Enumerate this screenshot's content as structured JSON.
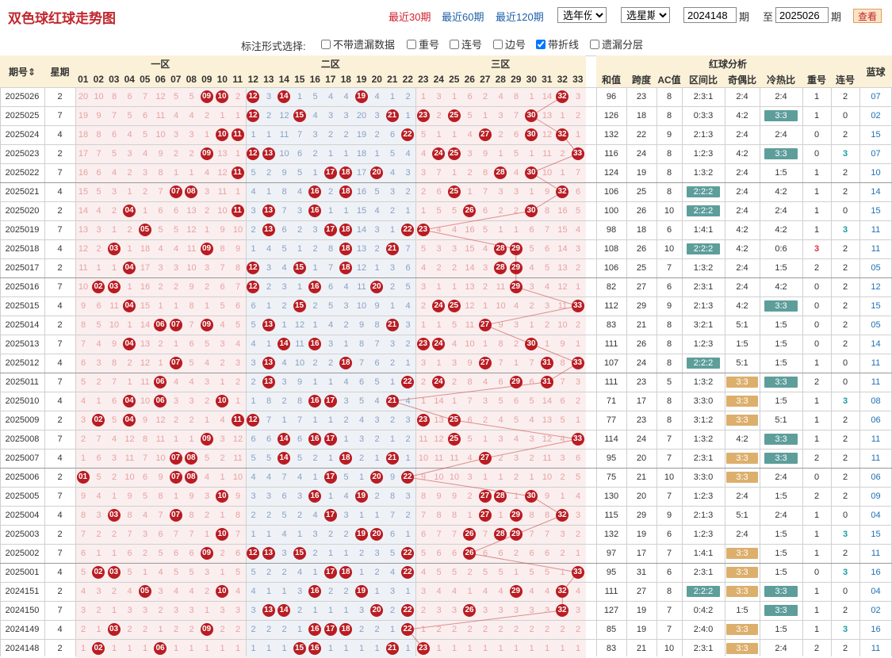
{
  "header": {
    "title": "双色球红球走势图",
    "periods": [
      "最近30期",
      "最近60期",
      "最近120期"
    ],
    "year_select": "选年份",
    "week_select": "选星期",
    "from_value": "2024148",
    "period_unit": "期",
    "to_label": "至",
    "to_value": "2025026",
    "query_button": "查看"
  },
  "options": {
    "label": "标注形式选择:",
    "items": [
      {
        "label": "不带遗漏数据",
        "checked": false
      },
      {
        "label": "重号",
        "checked": false
      },
      {
        "label": "连号",
        "checked": false
      },
      {
        "label": "边号",
        "checked": false
      },
      {
        "label": "带折线",
        "checked": true
      },
      {
        "label": "遗漏分层",
        "checked": false
      }
    ]
  },
  "table_header": {
    "period": "期号",
    "weekday": "星期",
    "zones": [
      "一区",
      "二区",
      "三区"
    ],
    "analysis": "红球分析",
    "blue": "蓝球",
    "analysis_cols": [
      "和值",
      "跨度",
      "AC值",
      "区间比",
      "奇偶比",
      "冷热比",
      "重号",
      "连号"
    ],
    "numbers": [
      "01",
      "02",
      "03",
      "04",
      "05",
      "06",
      "07",
      "08",
      "09",
      "10",
      "11",
      "12",
      "13",
      "14",
      "15",
      "16",
      "17",
      "18",
      "19",
      "20",
      "21",
      "22",
      "23",
      "24",
      "25",
      "26",
      "27",
      "28",
      "29",
      "30",
      "31",
      "32",
      "33"
    ]
  },
  "colors": {
    "ball": "#b91c22",
    "header_bg": "#fbf1d8",
    "badge_teal": "#5d9e9b",
    "badge_gold": "#dcaf6c",
    "blue_text": "#1e6fb5",
    "teal_text": "#1b9aa6",
    "red_text": "#e0303a"
  },
  "rows": [
    {
      "period": "2025026",
      "weekday": "2",
      "balls": [
        "09",
        "10",
        "12",
        "14",
        "19",
        "32"
      ],
      "sum": "96",
      "span": "23",
      "ac": "8",
      "zone": "2:3:1",
      "oe": "2:4",
      "ch": "2:4",
      "repeat": "1",
      "consec": "2",
      "blue": "07"
    },
    {
      "period": "2025025",
      "weekday": "7",
      "balls": [
        "12",
        "15",
        "21",
        "23",
        "25",
        "30"
      ],
      "sum": "126",
      "span": "18",
      "ac": "8",
      "zone": "0:3:3",
      "oe": "4:2",
      "ch": "3:3",
      "repeat": "1",
      "consec": "0",
      "blue": "02"
    },
    {
      "period": "2025024",
      "weekday": "4",
      "balls": [
        "10",
        "11",
        "22",
        "27",
        "30",
        "32"
      ],
      "sum": "132",
      "span": "22",
      "ac": "9",
      "zone": "2:1:3",
      "oe": "2:4",
      "ch": "2:4",
      "repeat": "0",
      "consec": "2",
      "blue": "15"
    },
    {
      "period": "2025023",
      "weekday": "2",
      "balls": [
        "09",
        "12",
        "13",
        "24",
        "25",
        "33"
      ],
      "sum": "116",
      "span": "24",
      "ac": "8",
      "zone": "1:2:3",
      "oe": "4:2",
      "ch": "3:3",
      "repeat": "0",
      "consec": "3",
      "blue": "07"
    },
    {
      "period": "2025022",
      "weekday": "7",
      "balls": [
        "11",
        "17",
        "18",
        "20",
        "28",
        "30"
      ],
      "sum": "124",
      "span": "19",
      "ac": "8",
      "zone": "1:3:2",
      "oe": "2:4",
      "ch": "1:5",
      "repeat": "1",
      "consec": "2",
      "blue": "10"
    },
    {
      "period": "2025021",
      "weekday": "4",
      "balls": [
        "07",
        "08",
        "16",
        "18",
        "25",
        "32"
      ],
      "sum": "106",
      "span": "25",
      "ac": "8",
      "zone": "2:2:2",
      "oe": "2:4",
      "ch": "4:2",
      "repeat": "1",
      "consec": "2",
      "blue": "14"
    },
    {
      "period": "2025020",
      "weekday": "2",
      "balls": [
        "04",
        "11",
        "13",
        "16",
        "26",
        "30"
      ],
      "sum": "100",
      "span": "26",
      "ac": "10",
      "zone": "2:2:2",
      "oe": "2:4",
      "ch": "2:4",
      "repeat": "1",
      "consec": "0",
      "blue": "15"
    },
    {
      "period": "2025019",
      "weekday": "7",
      "balls": [
        "05",
        "13",
        "17",
        "18",
        "22",
        "23"
      ],
      "sum": "98",
      "span": "18",
      "ac": "6",
      "zone": "1:4:1",
      "oe": "4:2",
      "ch": "4:2",
      "repeat": "1",
      "consec": "3",
      "blue": "11"
    },
    {
      "period": "2025018",
      "weekday": "4",
      "balls": [
        "03",
        "09",
        "18",
        "21",
        "28",
        "29"
      ],
      "sum": "108",
      "span": "26",
      "ac": "10",
      "zone": "2:2:2",
      "oe": "4:2",
      "ch": "0:6",
      "repeat": "3",
      "consec": "2",
      "blue": "11"
    },
    {
      "period": "2025017",
      "weekday": "2",
      "balls": [
        "04",
        "12",
        "15",
        "18",
        "28",
        "29"
      ],
      "sum": "106",
      "span": "25",
      "ac": "7",
      "zone": "1:3:2",
      "oe": "2:4",
      "ch": "1:5",
      "repeat": "2",
      "consec": "2",
      "blue": "05"
    },
    {
      "period": "2025016",
      "weekday": "7",
      "balls": [
        "02",
        "03",
        "12",
        "16",
        "20",
        "29"
      ],
      "sum": "82",
      "span": "27",
      "ac": "6",
      "zone": "2:3:1",
      "oe": "2:4",
      "ch": "4:2",
      "repeat": "0",
      "consec": "2",
      "blue": "12"
    },
    {
      "period": "2025015",
      "weekday": "4",
      "balls": [
        "04",
        "15",
        "24",
        "25",
        "33"
      ],
      "sum": "112",
      "span": "29",
      "ac": "9",
      "zone": "2:1:3",
      "oe": "4:2",
      "ch": "3:3",
      "repeat": "0",
      "consec": "2",
      "blue": "15"
    },
    {
      "period": "2025014",
      "weekday": "2",
      "balls": [
        "06",
        "07",
        "09",
        "13",
        "21",
        "27"
      ],
      "sum": "83",
      "span": "21",
      "ac": "8",
      "zone": "3:2:1",
      "oe": "5:1",
      "ch": "1:5",
      "repeat": "0",
      "consec": "2",
      "blue": "05"
    },
    {
      "period": "2025013",
      "weekday": "7",
      "balls": [
        "04",
        "14",
        "16",
        "23",
        "24",
        "30"
      ],
      "sum": "111",
      "span": "26",
      "ac": "8",
      "zone": "1:2:3",
      "oe": "1:5",
      "ch": "1:5",
      "repeat": "0",
      "consec": "2",
      "blue": "14"
    },
    {
      "period": "2025012",
      "weekday": "4",
      "balls": [
        "07",
        "13",
        "18",
        "27",
        "31",
        "33"
      ],
      "sum": "107",
      "span": "24",
      "ac": "8",
      "zone": "2:2:2",
      "oe": "5:1",
      "ch": "1:5",
      "repeat": "1",
      "consec": "0",
      "blue": "11"
    },
    {
      "period": "2025011",
      "weekday": "7",
      "balls": [
        "06",
        "13",
        "22",
        "24",
        "29",
        "31"
      ],
      "sum": "111",
      "span": "23",
      "ac": "5",
      "zone": "1:3:2",
      "oe": "3:3",
      "ch": "3:3",
      "repeat": "2",
      "consec": "0",
      "blue": "11"
    },
    {
      "period": "2025010",
      "weekday": "4",
      "balls": [
        "04",
        "06",
        "10",
        "16",
        "17",
        "21"
      ],
      "sum": "71",
      "span": "17",
      "ac": "8",
      "zone": "3:3:0",
      "oe": "3:3",
      "ch": "1:5",
      "repeat": "1",
      "consec": "3",
      "blue": "08"
    },
    {
      "period": "2025009",
      "weekday": "2",
      "balls": [
        "02",
        "04",
        "11",
        "12",
        "23",
        "25"
      ],
      "sum": "77",
      "span": "23",
      "ac": "8",
      "zone": "3:1:2",
      "oe": "3:3",
      "ch": "5:1",
      "repeat": "1",
      "consec": "2",
      "blue": "06"
    },
    {
      "period": "2025008",
      "weekday": "7",
      "balls": [
        "09",
        "14",
        "16",
        "17",
        "25",
        "33"
      ],
      "sum": "114",
      "span": "24",
      "ac": "7",
      "zone": "1:3:2",
      "oe": "4:2",
      "ch": "3:3",
      "repeat": "1",
      "consec": "2",
      "blue": "11"
    },
    {
      "period": "2025007",
      "weekday": "4",
      "balls": [
        "07",
        "08",
        "14",
        "18",
        "21",
        "27"
      ],
      "sum": "95",
      "span": "20",
      "ac": "7",
      "zone": "2:3:1",
      "oe": "3:3",
      "ch": "3:3",
      "repeat": "2",
      "consec": "2",
      "blue": "11"
    },
    {
      "period": "2025006",
      "weekday": "2",
      "balls": [
        "01",
        "07",
        "08",
        "17",
        "20",
        "22"
      ],
      "sum": "75",
      "span": "21",
      "ac": "10",
      "zone": "3:3:0",
      "oe": "3:3",
      "ch": "2:4",
      "repeat": "0",
      "consec": "2",
      "blue": "06"
    },
    {
      "period": "2025005",
      "weekday": "7",
      "balls": [
        "10",
        "16",
        "19",
        "27",
        "28",
        "30"
      ],
      "sum": "130",
      "span": "20",
      "ac": "7",
      "zone": "1:2:3",
      "oe": "2:4",
      "ch": "1:5",
      "repeat": "2",
      "consec": "2",
      "blue": "09"
    },
    {
      "period": "2025004",
      "weekday": "4",
      "balls": [
        "03",
        "07",
        "17",
        "27",
        "29",
        "32"
      ],
      "sum": "115",
      "span": "29",
      "ac": "9",
      "zone": "2:1:3",
      "oe": "5:1",
      "ch": "2:4",
      "repeat": "1",
      "consec": "0",
      "blue": "04"
    },
    {
      "period": "2025003",
      "weekday": "2",
      "balls": [
        "10",
        "19",
        "20",
        "26",
        "28",
        "29"
      ],
      "sum": "132",
      "span": "19",
      "ac": "6",
      "zone": "1:2:3",
      "oe": "2:4",
      "ch": "1:5",
      "repeat": "1",
      "consec": "3",
      "blue": "15"
    },
    {
      "period": "2025002",
      "weekday": "7",
      "balls": [
        "09",
        "12",
        "13",
        "15",
        "22",
        "26"
      ],
      "sum": "97",
      "span": "17",
      "ac": "7",
      "zone": "1:4:1",
      "oe": "3:3",
      "ch": "1:5",
      "repeat": "1",
      "consec": "2",
      "blue": "11"
    },
    {
      "period": "2025001",
      "weekday": "4",
      "balls": [
        "02",
        "03",
        "17",
        "18",
        "22",
        "33"
      ],
      "sum": "95",
      "span": "31",
      "ac": "6",
      "zone": "2:3:1",
      "oe": "3:3",
      "ch": "1:5",
      "repeat": "0",
      "consec": "3",
      "blue": "16"
    },
    {
      "period": "2024151",
      "weekday": "2",
      "balls": [
        "05",
        "10",
        "16",
        "19",
        "29",
        "32"
      ],
      "sum": "111",
      "span": "27",
      "ac": "8",
      "zone": "2:2:2",
      "oe": "3:3",
      "ch": "3:3",
      "repeat": "1",
      "consec": "0",
      "blue": "04"
    },
    {
      "period": "2024150",
      "weekday": "7",
      "balls": [
        "13",
        "14",
        "20",
        "22",
        "26",
        "32"
      ],
      "sum": "127",
      "span": "19",
      "ac": "7",
      "zone": "0:4:2",
      "oe": "1:5",
      "ch": "3:3",
      "repeat": "1",
      "consec": "2",
      "blue": "02"
    },
    {
      "period": "2024149",
      "weekday": "4",
      "balls": [
        "03",
        "09",
        "16",
        "17",
        "18",
        "22"
      ],
      "sum": "85",
      "span": "19",
      "ac": "7",
      "zone": "2:4:0",
      "oe": "3:3",
      "ch": "1:5",
      "repeat": "1",
      "consec": "3",
      "blue": "16"
    },
    {
      "period": "2024148",
      "weekday": "2",
      "balls": [
        "02",
        "06",
        "15",
        "16",
        "21",
        "23"
      ],
      "sum": "83",
      "span": "21",
      "ac": "10",
      "zone": "2:3:1",
      "oe": "3:3",
      "ch": "2:4",
      "repeat": "2",
      "consec": "2",
      "blue": "11"
    }
  ]
}
